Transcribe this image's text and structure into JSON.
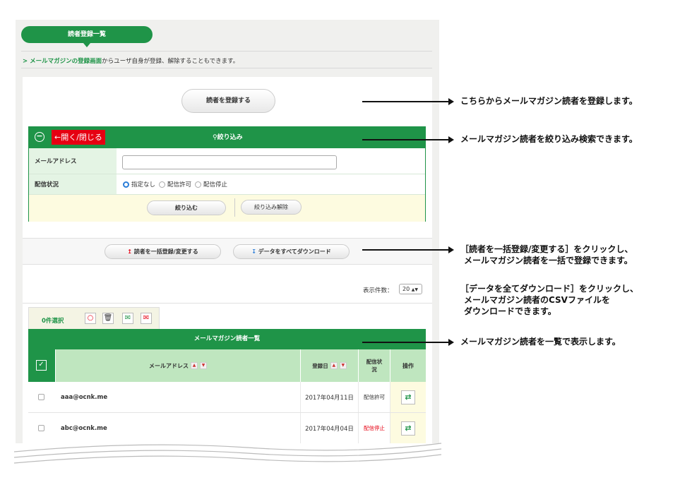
{
  "header": {
    "tab_title": "読者登録一覧"
  },
  "description": {
    "link": "メールマガジンの登録画面",
    "text": "からユーザ自身が登録、解除することもできます。"
  },
  "register_button": "読者を登録する",
  "filter": {
    "toggle_label": "←開く/閉じる",
    "title": "絞り込み",
    "email_label": "メールアドレス",
    "email_value": "",
    "status_label": "配信状況",
    "status_options": [
      "指定なし",
      "配信許可",
      "配信停止"
    ],
    "status_selected": "指定なし",
    "apply_button": "絞り込む",
    "clear_button": "絞り込み解除"
  },
  "bulk_button": "読者を一括登録/変更する",
  "download_button": "データをすべてダウンロード",
  "display_count": {
    "label": "表示件数：",
    "value": "20"
  },
  "selection": {
    "label": "0件選択"
  },
  "list": {
    "title": "メールマガジン読者一覧",
    "columns": {
      "email": "メールアドレス",
      "date": "登録日",
      "status": "配信状況",
      "action": "操作"
    },
    "rows": [
      {
        "email": "aaa@ocnk.me",
        "date": "2017年04月11日",
        "status": "配信許可",
        "status_color": "#333333"
      },
      {
        "email": "abc@ocnk.me",
        "date": "2017年04月04日",
        "status": "配信停止",
        "status_color": "#e60012"
      }
    ]
  },
  "annotations": {
    "register": "こちらからメールマガジン読者を登録します。",
    "filter": "メールマガジン読者を絞り込み検索できます。",
    "bulk_line1": "［読者を一括登録/変更する］をクリックし、",
    "bulk_line2": "メールマガジン読者を一括で登録できます。",
    "download_line1": "［データを全てダウンロード］をクリックし、",
    "download_line2": "メールマガジン読者のCSVファイルを",
    "download_line3": "ダウンロードできます。",
    "list": "メールマガジン読者を一覧で表示します。"
  },
  "colors": {
    "accent": "#1f9448",
    "toggle": "#e60012",
    "header_light": "#bfe6bf"
  }
}
